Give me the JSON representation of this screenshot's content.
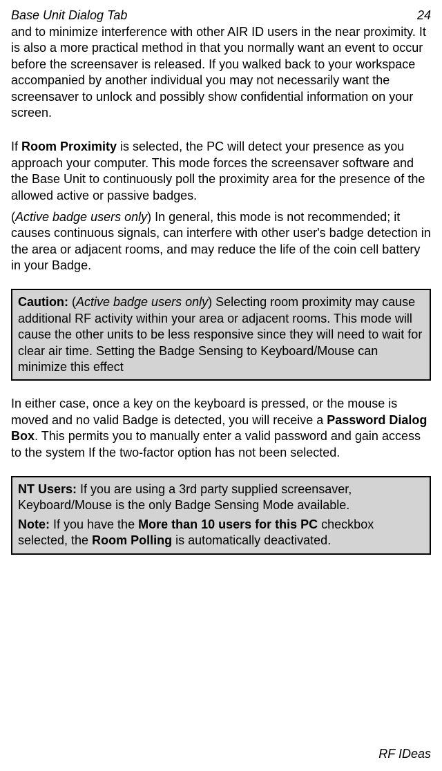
{
  "header": {
    "title": "Base Unit Dialog Tab",
    "page": "24"
  },
  "p1": "and to minimize interference with other AIR ID users in the near proximity. It is also a more practical method in that you normally want an event to occur before the screensaver is released. If you walked back to your workspace accompanied by another individual you may not necessarily want the screensaver to unlock and possibly show confidential information on your screen.",
  "p2": {
    "pre": "If ",
    "bold": "Room Proximity",
    "post": " is selected, the PC will detect your presence as you approach your computer.  This mode forces the screensaver software and the Base Unit to continuously poll the proximity area for the presence of the allowed active or passive badges."
  },
  "p3": {
    "open": "(",
    "italic": "Active badge users only",
    "post": ") In general, this mode is not recommended; it causes continuous signals, can interfere with other user's badge detection in the area or adjacent rooms, and may reduce the life of the coin cell battery in your Badge."
  },
  "caution": {
    "label": "Caution:",
    "open": " (",
    "italic": "Active badge users only",
    "post": ") Selecting room proximity may cause additional RF activity within your area or adjacent rooms. This mode will cause the other units to be less responsive since they will need to wait for clear air time. Setting the Badge Sensing to Keyboard/Mouse can minimize this effect"
  },
  "p4": {
    "pre": "In either case, once a key on the keyboard is pressed, or the mouse is moved and no valid Badge is detected, you will receive a ",
    "bold": "Password Dialog Box",
    "post": ".  This permits you to manually enter a valid password and gain access to the system If the two-factor option has not been selected."
  },
  "nt": {
    "line1": {
      "label": "NT Users:",
      "text": " If you are using a 3rd party supplied screensaver, Keyboard/Mouse is the only Badge Sensing Mode available."
    },
    "line2": {
      "label": "Note:",
      "pre": " If you have the ",
      "bold1": "More than 10 users for this PC",
      "mid": " checkbox selected, the ",
      "bold2": "Room Polling",
      "post": " is automatically deactivated."
    }
  },
  "footer": "RF IDeas"
}
